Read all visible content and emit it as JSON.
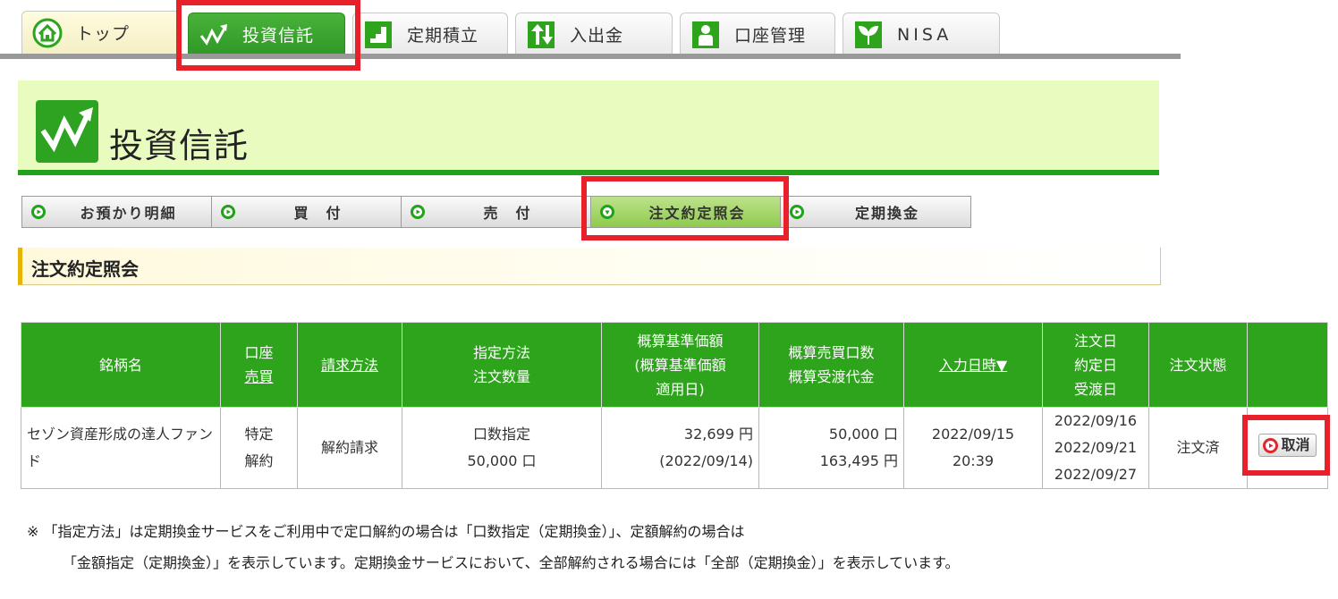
{
  "top_tabs": [
    {
      "label": "トップ",
      "icon": "home-icon"
    },
    {
      "label": "投資信託",
      "icon": "trend-icon",
      "active": true
    },
    {
      "label": "定期積立",
      "icon": "steps-icon"
    },
    {
      "label": "入出金",
      "icon": "transfer-arrows-icon"
    },
    {
      "label": "口座管理",
      "icon": "person-icon"
    },
    {
      "label": "NISA",
      "icon": "sprout-icon"
    }
  ],
  "banner": {
    "title": "投資信託",
    "icon": "trend-icon"
  },
  "sub_nav": [
    {
      "label": "お預かり明細"
    },
    {
      "label": "買　付"
    },
    {
      "label": "売　付"
    },
    {
      "label": "注文約定照会",
      "active": true
    },
    {
      "label": "定期換金"
    }
  ],
  "section_title": "注文約定照会",
  "table": {
    "headers": {
      "fund_name": "銘柄名",
      "account_line1": "口座",
      "account_line2": "売買",
      "request_method": "請求方法",
      "method_line1": "指定方法",
      "method_line2": "注文数量",
      "price_line1": "概算基準価額",
      "price_line2": "(概算基準価額",
      "price_line3": "適用日)",
      "units_line1": "概算売買口数",
      "units_line2": "概算受渡代金",
      "input_datetime": "入力日時▼",
      "dates_line1": "注文日",
      "dates_line2": "約定日",
      "dates_line3": "受渡日",
      "status": "注文状態"
    },
    "rows": [
      {
        "fund_name": "セゾン資産形成の達人ファンド",
        "account": "特定",
        "trade_type": "解約",
        "request_method": "解約請求",
        "designation": "口数指定",
        "quantity": "50,000 口",
        "nav_price": "32,699 円",
        "nav_date": "(2022/09/14)",
        "est_units": "50,000 口",
        "est_amount": "163,495 円",
        "input_date": "2022/09/15",
        "input_time": "20:39",
        "order_date": "2022/09/16",
        "execution_date": "2022/09/21",
        "settlement_date": "2022/09/27",
        "status": "注文済",
        "cancel_label": "取消"
      }
    ]
  },
  "notes": {
    "line1": "※ 「指定方法」は定期換金サービスをご利用中で定口解約の場合は「口数指定（定期換金）」、定額解約の場合は",
    "line2": "「金額指定（定期換金）」を表示しています。定期換金サービスにおいて、全部解約される場合には「全部（定期換金）」を表示しています。"
  },
  "colors": {
    "brand_green": "#2ea31c",
    "highlight_red": "#e8202a",
    "banner_bg": "#e8fcc0"
  }
}
